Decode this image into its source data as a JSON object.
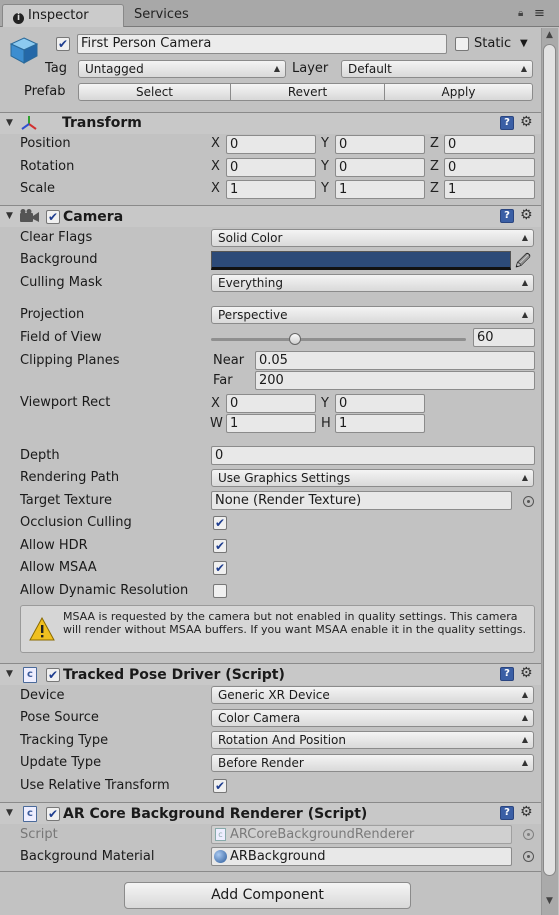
{
  "tabs": {
    "inspector": "Inspector",
    "services": "Services"
  },
  "header": {
    "object_name": "First Person Camera",
    "static_label": "Static",
    "tag_label": "Tag",
    "tag_value": "Untagged",
    "layer_label": "Layer",
    "layer_value": "Default",
    "prefab_label": "Prefab",
    "prefab_buttons": {
      "select": "Select",
      "revert": "Revert",
      "apply": "Apply"
    }
  },
  "transform": {
    "title": "Transform",
    "rows": [
      {
        "label": "Position",
        "x": "0",
        "y": "0",
        "z": "0"
      },
      {
        "label": "Rotation",
        "x": "0",
        "y": "0",
        "z": "0"
      },
      {
        "label": "Scale",
        "x": "1",
        "y": "1",
        "z": "1"
      }
    ],
    "axes": {
      "x": "X",
      "y": "Y",
      "z": "Z"
    }
  },
  "camera": {
    "title": "Camera",
    "clear_flags": {
      "label": "Clear Flags",
      "value": "Solid Color"
    },
    "background": {
      "label": "Background",
      "color": "#2c4a78"
    },
    "culling_mask": {
      "label": "Culling Mask",
      "value": "Everything"
    },
    "projection": {
      "label": "Projection",
      "value": "Perspective"
    },
    "fov": {
      "label": "Field of View",
      "value": "60",
      "fraction": 0.33
    },
    "clipping": {
      "label": "Clipping Planes",
      "near_label": "Near",
      "near": "0.05",
      "far_label": "Far",
      "far": "200"
    },
    "viewport": {
      "label": "Viewport Rect",
      "x_label": "X",
      "x": "0",
      "y_label": "Y",
      "y": "0",
      "w_label": "W",
      "w": "1",
      "h_label": "H",
      "h": "1"
    },
    "depth": {
      "label": "Depth",
      "value": "0"
    },
    "rendering_path": {
      "label": "Rendering Path",
      "value": "Use Graphics Settings"
    },
    "target_texture": {
      "label": "Target Texture",
      "value": "None (Render Texture)"
    },
    "occlusion_culling": {
      "label": "Occlusion Culling",
      "checked": true
    },
    "allow_hdr": {
      "label": "Allow HDR",
      "checked": true
    },
    "allow_msaa": {
      "label": "Allow MSAA",
      "checked": true
    },
    "allow_dynamic_resolution": {
      "label": "Allow Dynamic Resolution",
      "checked": false
    },
    "warning": "MSAA is requested by the camera but not enabled in quality settings. This camera will render without MSAA buffers. If you want MSAA enable it in the quality settings."
  },
  "tracked_pose": {
    "title": "Tracked Pose Driver (Script)",
    "device": {
      "label": "Device",
      "value": "Generic XR Device"
    },
    "pose_source": {
      "label": "Pose Source",
      "value": "Color Camera"
    },
    "tracking_type": {
      "label": "Tracking Type",
      "value": "Rotation And Position"
    },
    "update_type": {
      "label": "Update Type",
      "value": "Before Render"
    },
    "use_relative": {
      "label": "Use Relative Transform",
      "checked": true
    }
  },
  "ar_core": {
    "title": "AR Core Background Renderer (Script)",
    "script": {
      "label": "Script",
      "value": "ARCoreBackgroundRenderer"
    },
    "material": {
      "label": "Background Material",
      "value": "ARBackground"
    }
  },
  "add_component": "Add Component",
  "check_glyph": "✔"
}
